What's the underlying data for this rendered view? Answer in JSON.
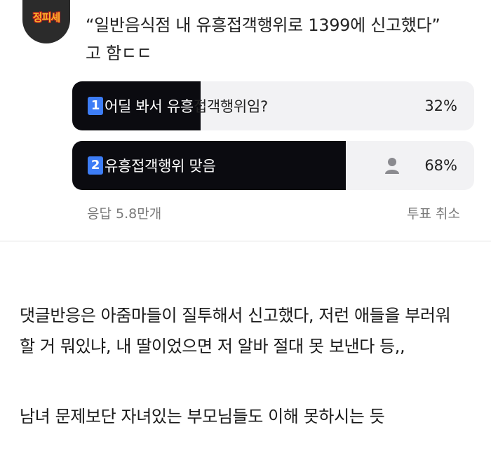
{
  "post": {
    "avatar_text": "정피셰",
    "question_line1": "“일반음식점 내 유흥접객행위로 1399에 신고했다”",
    "question_line2": "고 함ㄷㄷ"
  },
  "poll": {
    "options": [
      {
        "number": "1",
        "label_white": "어딜 봐서 유흥",
        "label_dark": "접객행위임?",
        "percent": "32%",
        "fraction": 0.32
      },
      {
        "number": "2",
        "label_white": "유흥접객행위 맞음",
        "label_dark": "",
        "percent": "68%",
        "fraction": 0.68,
        "selected_icon": "user-icon"
      }
    ],
    "responses": "응답 5.8만개",
    "cancel_vote": "투표 취소"
  },
  "content": {
    "paragraph1_line1": "댓글반응은 아줌마들이 질투해서 신고했다, 저런 애들을 부러워",
    "paragraph1_line2": "할 거 뭐있냐, 내 딸이었으면 저 알바 절대 못 보낸다 등,,",
    "paragraph2": "남녀 문제보단 자녀있는 부모님들도 이해 못하시는 듯"
  },
  "colors": {
    "fill": "#0b0b10",
    "track": "#f2f2f4",
    "number_badge": "#3d7df6",
    "meta_text": "#7a7a7a"
  }
}
